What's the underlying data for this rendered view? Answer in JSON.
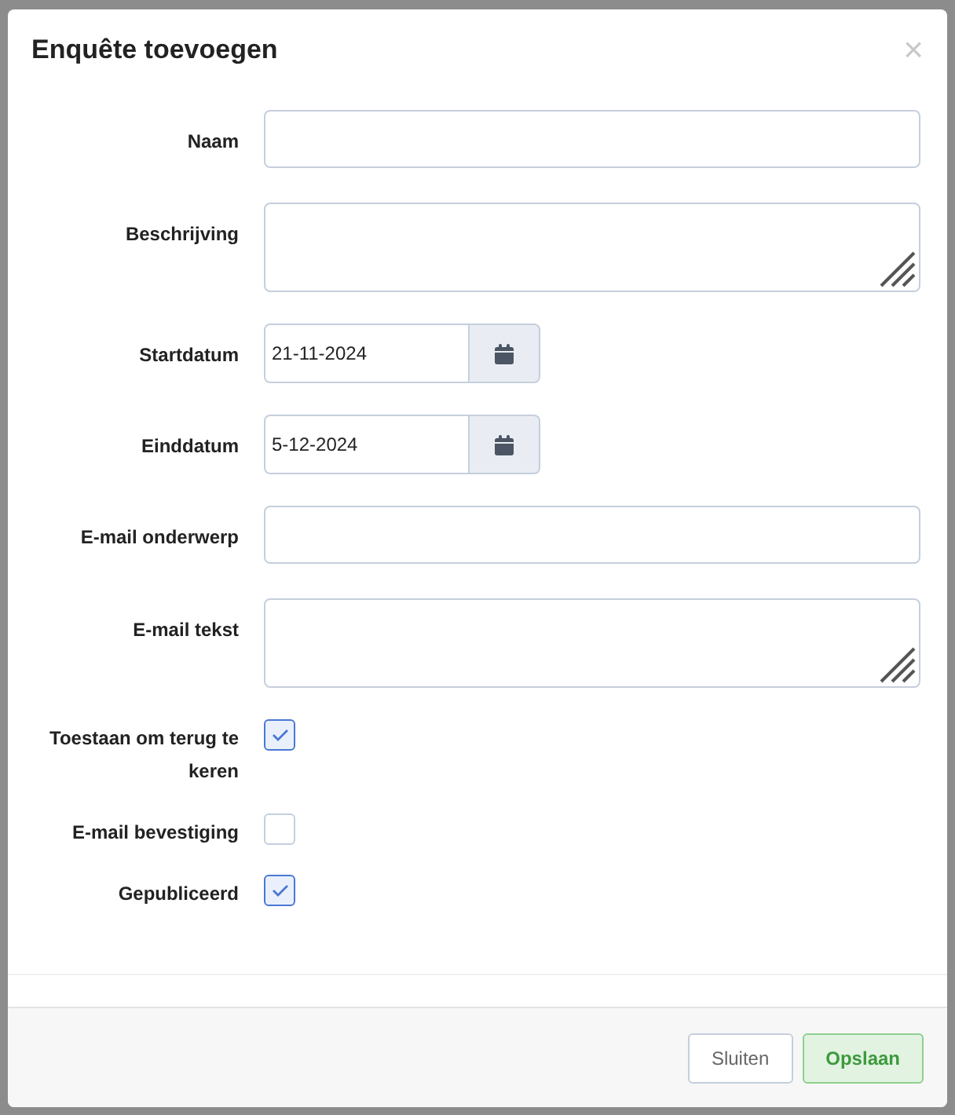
{
  "dialog": {
    "title": "Enquête toevoegen",
    "close_label": "×"
  },
  "fields": [
    {
      "kind": "text",
      "label": "Naam"
    },
    {
      "kind": "textarea",
      "label": "Beschrijving"
    },
    {
      "kind": "date",
      "label": "Startdatum",
      "value": "21-11-2024"
    },
    {
      "kind": "date",
      "label": "Einddatum",
      "value": "5-12-2024"
    },
    {
      "kind": "text",
      "label": "E-mail onderwerp"
    },
    {
      "kind": "textarea",
      "label": "E-mail tekst"
    },
    {
      "kind": "checkbox",
      "label": "Toestaan om terug te keren",
      "checked": true
    },
    {
      "kind": "checkbox",
      "label": "E-mail bevestiging",
      "checked": false
    },
    {
      "kind": "checkbox",
      "label": "Gepubliceerd",
      "checked": true
    }
  ],
  "buttons": [
    {
      "kind": "secondary",
      "label": "Sluiten"
    },
    {
      "kind": "primary",
      "label": "Opslaan"
    }
  ]
}
